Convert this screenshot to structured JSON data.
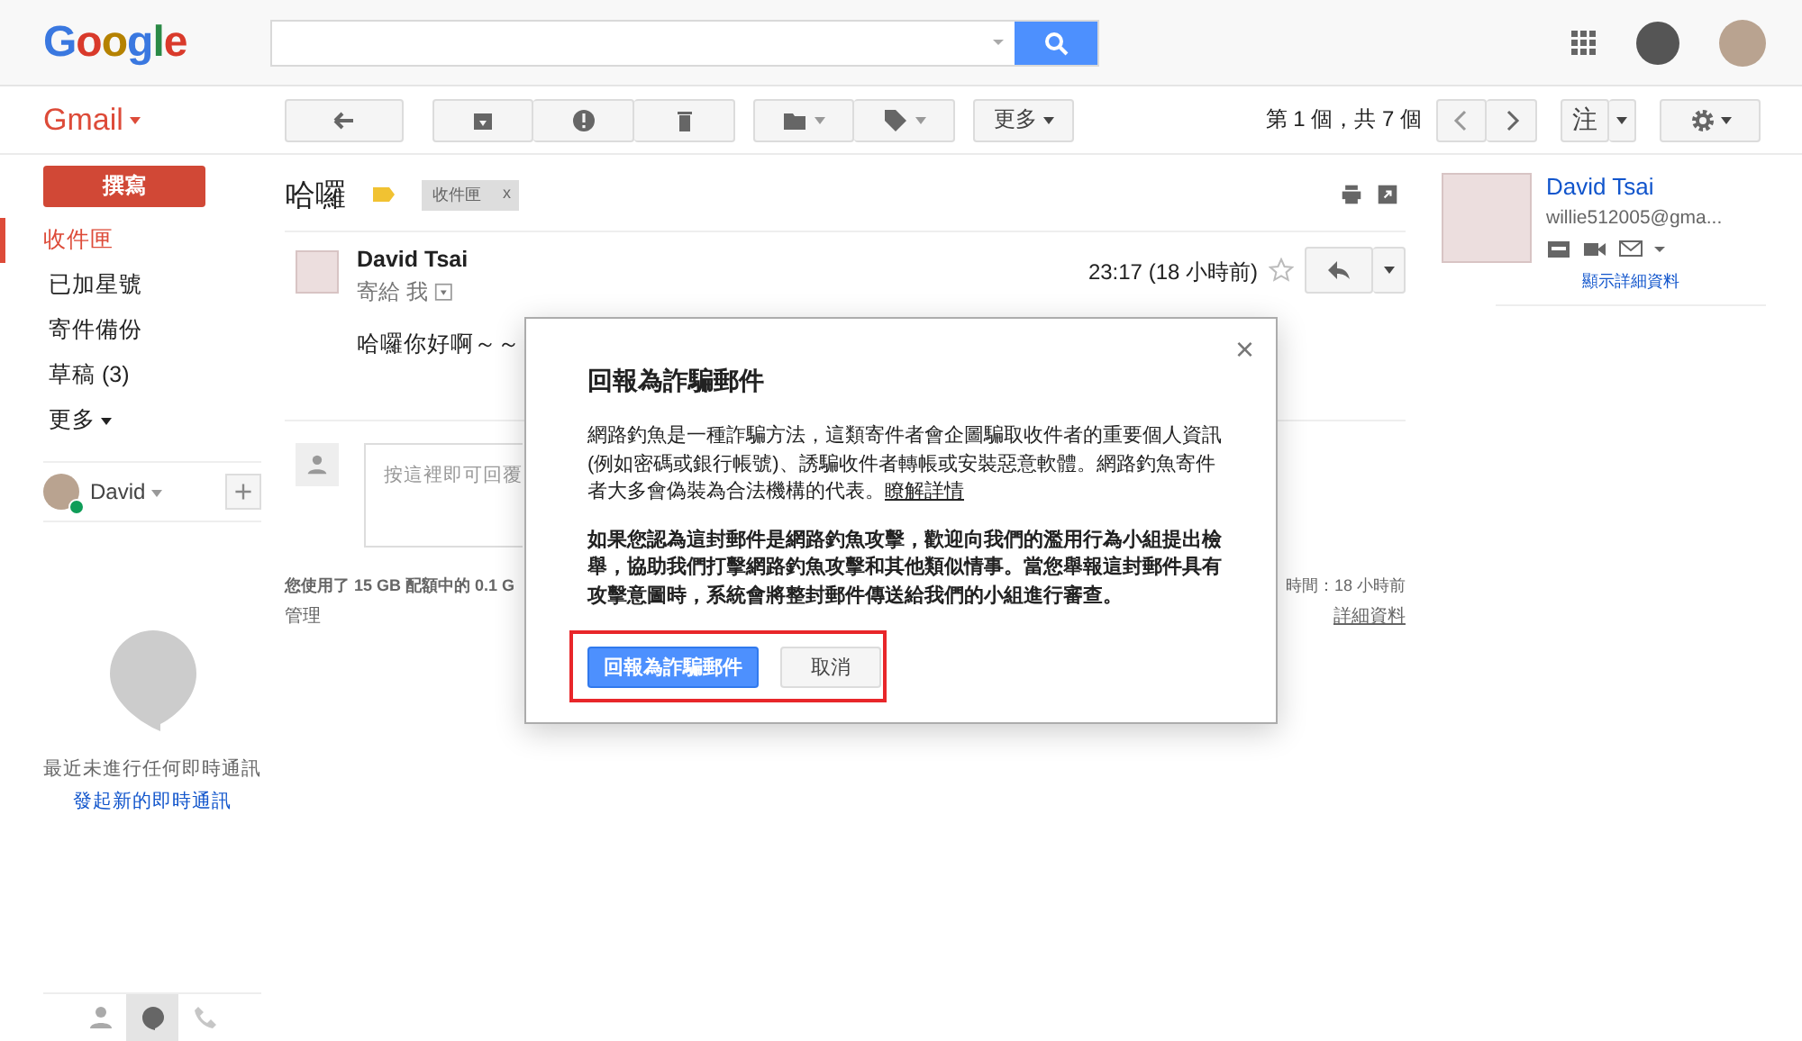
{
  "header": {
    "logo": "Google"
  },
  "app_menu": {
    "label": "Gmail"
  },
  "toolbar": {
    "more": "更多",
    "pagination": "第 1 個，共 7 個",
    "input_tool": "注"
  },
  "sidebar": {
    "compose": "撰寫",
    "items": [
      {
        "label": "收件匣",
        "selected": true
      },
      {
        "label": "已加星號",
        "selected": false
      },
      {
        "label": "寄件備份",
        "selected": false
      },
      {
        "label": "草稿 (3)",
        "selected": false
      }
    ],
    "more": "更多",
    "chat": {
      "user": "David",
      "online": true,
      "empty_text": "最近未進行任何即時通訊",
      "start_link": "發起新的即時通訊"
    },
    "bottom_tabs": [
      {
        "kind": "contacts",
        "selected": false
      },
      {
        "kind": "hangouts",
        "selected": true
      },
      {
        "kind": "phone",
        "selected": false
      }
    ]
  },
  "thread": {
    "subject": "哈囉",
    "labels": [
      {
        "label": "收件匣",
        "remove": "x"
      }
    ],
    "message": {
      "sender": "David Tsai",
      "to": "寄給 我",
      "time": "23:17 (18 小時前)",
      "starred": false,
      "body": "哈囉你好啊～～"
    },
    "reply_placeholder": "按這裡即可回覆",
    "footer": {
      "storage": "您使用了 15 GB 配額中的 0.1 G",
      "manage": "管理",
      "activity": "時間：18 小時前",
      "details": "詳細資料"
    }
  },
  "contact": {
    "name": "David Tsai",
    "email": "willie512005@gma...",
    "show_details": "顯示詳細資料"
  },
  "dialog": {
    "title": "回報為詐騙郵件",
    "paragraph": "網路釣魚是一種詐騙方法，這類寄件者會企圖騙取收件者的重要個人資訊(例如密碼或銀行帳號)、誘騙收件者轉帳或安裝惡意軟體。網路釣魚寄件者大多會偽裝為合法機構的代表。",
    "learn_more": "瞭解詳情",
    "notice": "如果您認為這封郵件是網路釣魚攻擊，歡迎向我們的濫用行為小組提出檢舉，協助我們打擊網路釣魚攻擊和其他類似情事。當您舉報這封郵件具有攻擊意圖時，系統會將整封郵件傳送給我們的小組進行審查。",
    "buttons": [
      {
        "label": "回報為詐騙郵件",
        "kind": "primary"
      },
      {
        "label": "取消",
        "kind": "secondary"
      }
    ],
    "close": "×",
    "highlighted": true
  }
}
